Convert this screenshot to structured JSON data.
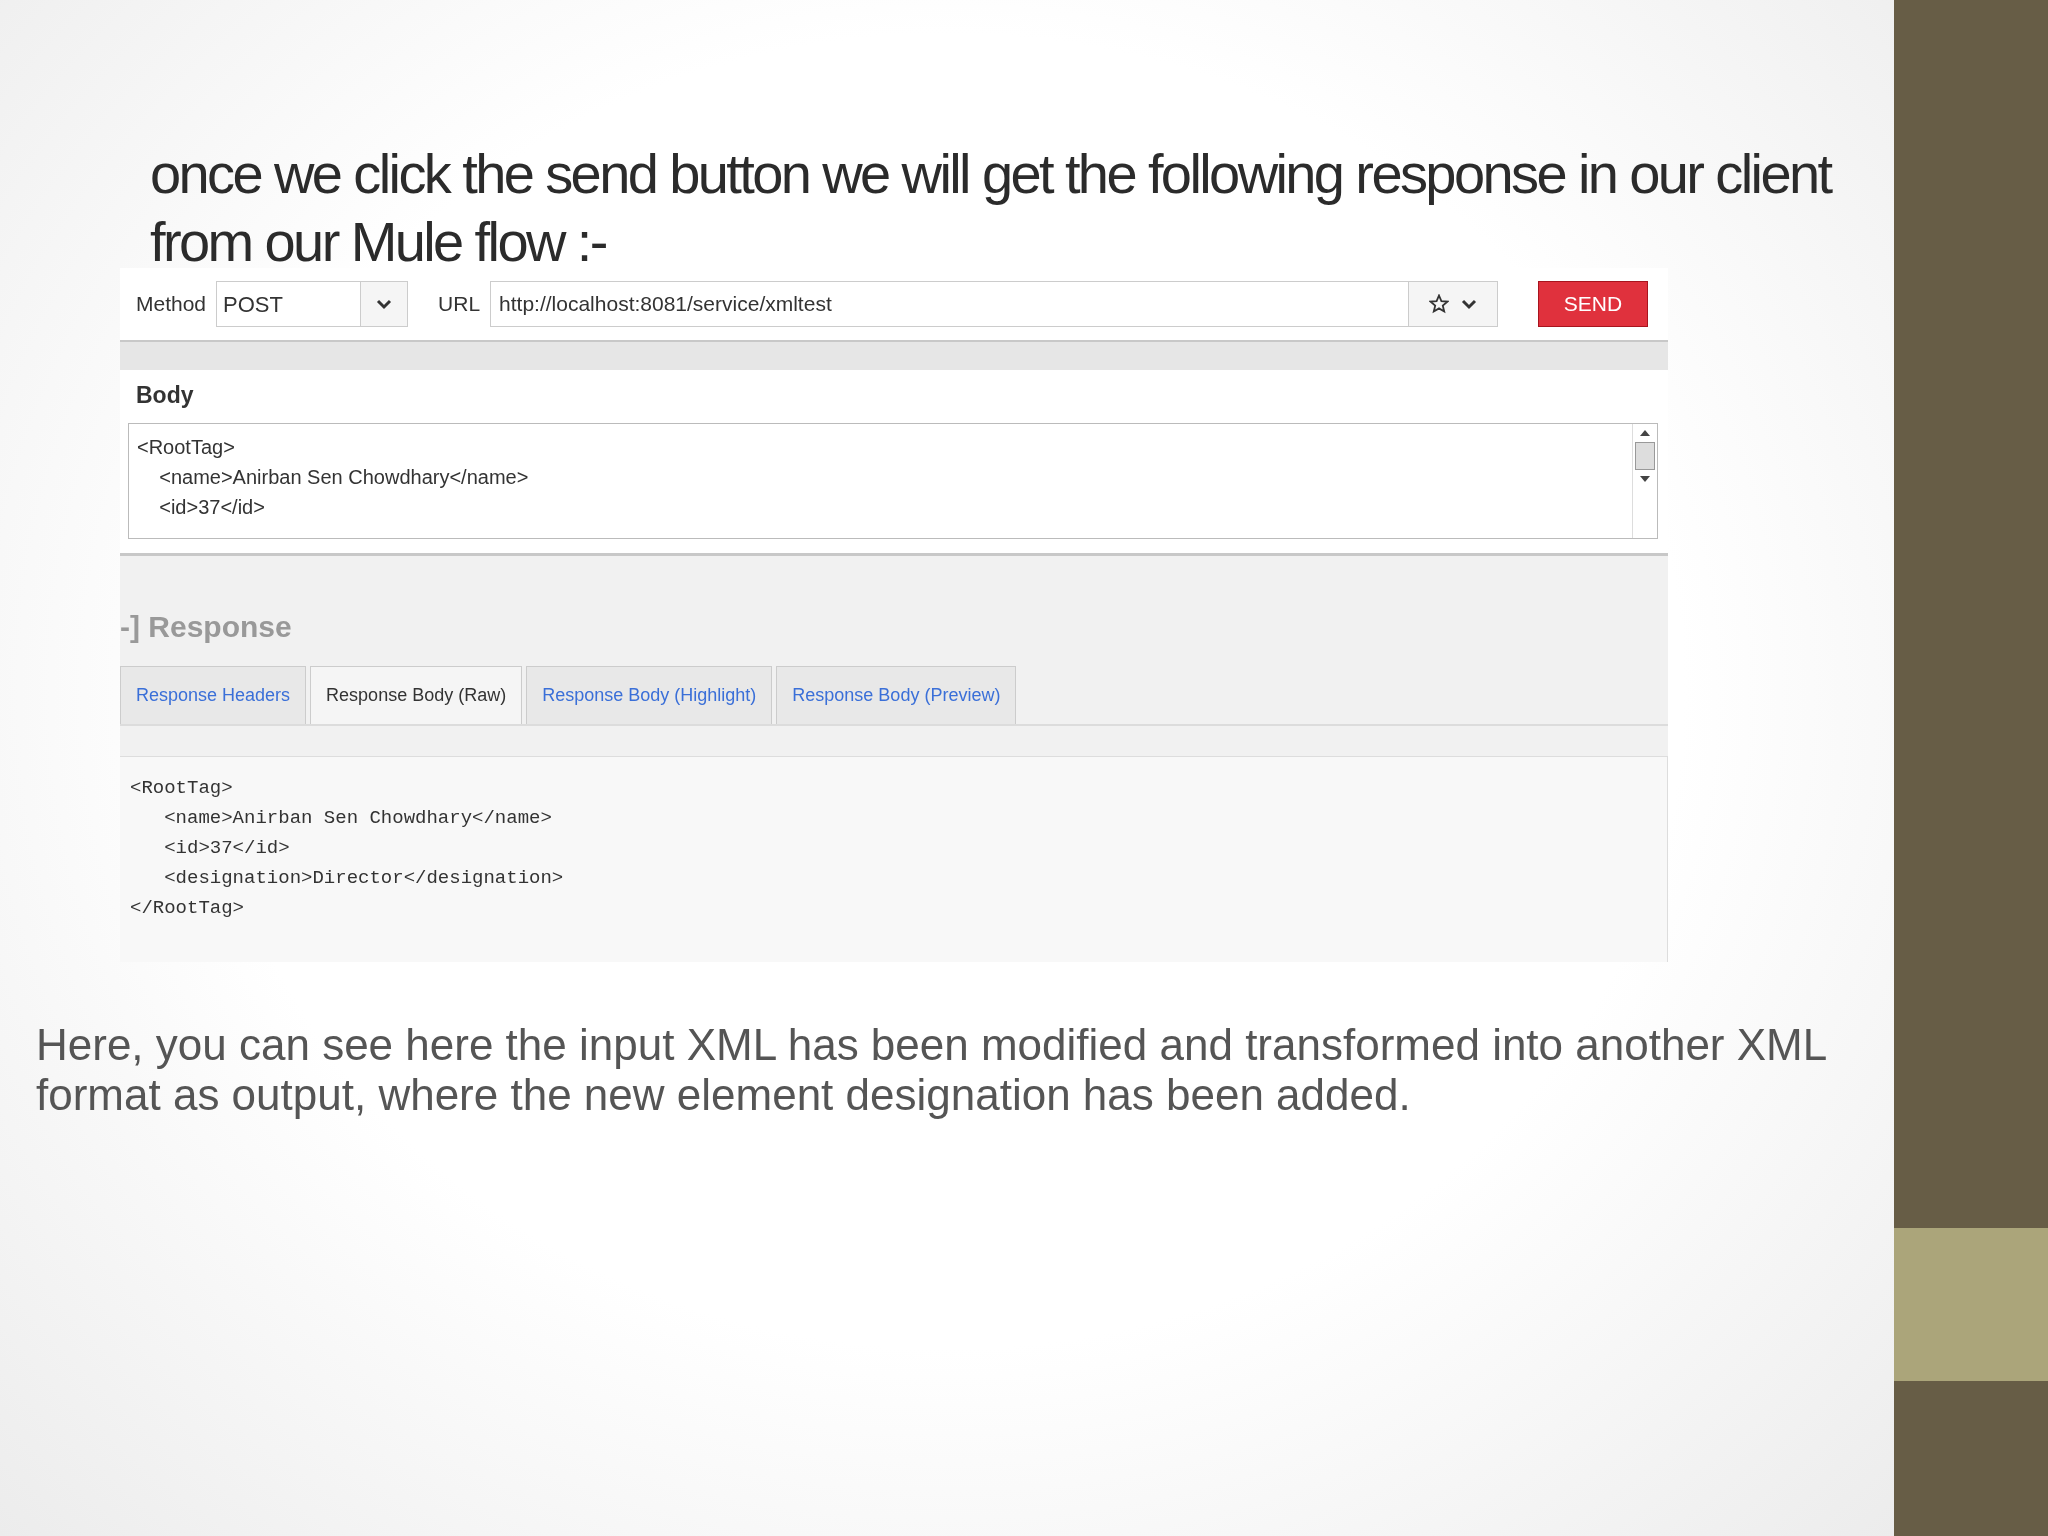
{
  "slide_title": "once we click the send button we will get the following response in our client from our Mule flow :-",
  "request": {
    "method_label": "Method",
    "method": "POST",
    "url_label": "URL",
    "url": "http://localhost:8081/service/xmltest",
    "send_button": "SEND"
  },
  "body": {
    "heading": "Body",
    "lines": [
      "<RootTag>",
      "    <name>Anirban Sen Chowdhary</name>",
      "    <id>37</id>"
    ]
  },
  "response": {
    "heading": "-] Response",
    "tabs": [
      {
        "label": "Response Headers",
        "selected": false
      },
      {
        "label": "Response Body (Raw)",
        "selected": true
      },
      {
        "label": "Response Body (Highlight)",
        "selected": false
      },
      {
        "label": "Response Body (Preview)",
        "selected": false
      }
    ],
    "lines": [
      "<RootTag>",
      "   <name>Anirban Sen Chowdhary</name>",
      "   <id>37</id>",
      "   <designation>Director</designation>",
      "</RootTag>"
    ]
  },
  "caption": "Here, you can see here the input XML has been modified and transformed into another XML format as output, where the new element designation has been added."
}
